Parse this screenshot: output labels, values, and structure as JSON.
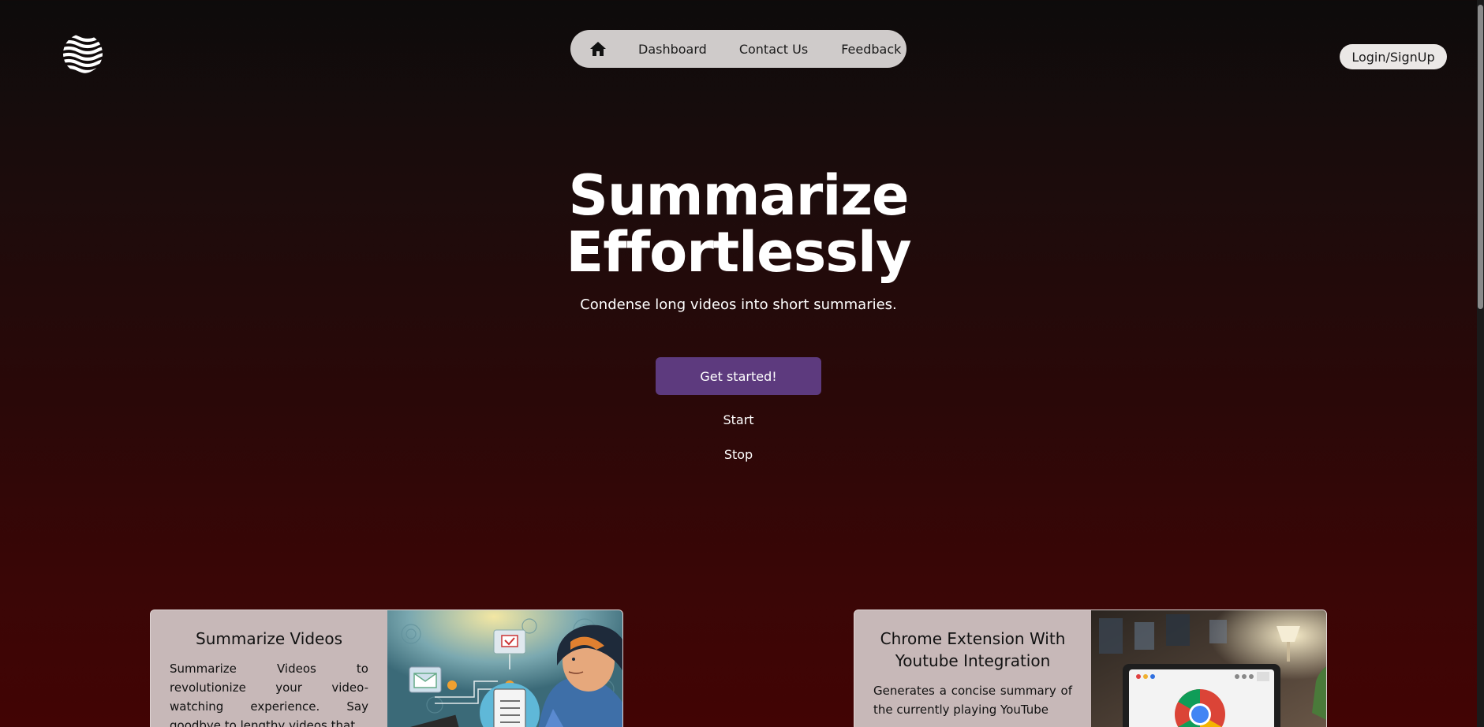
{
  "logo": {
    "icon": "wave-globe-logo"
  },
  "nav": {
    "home_icon": "home-icon",
    "items": [
      {
        "label": "Dashboard"
      },
      {
        "label": "Contact Us"
      },
      {
        "label": "Feedback"
      }
    ]
  },
  "auth": {
    "login_label": "Login/SignUp"
  },
  "hero": {
    "title_line1": "Summarize",
    "title_line2": "Effortlessly",
    "subtitle": "Condense long videos into short summaries.",
    "cta_label": "Get started!",
    "start_label": "Start",
    "stop_label": "Stop"
  },
  "cards": [
    {
      "title": "Summarize Videos",
      "description": "Summarize Videos to revolutionize your video-watching experience. Say goodbye to lengthy videos that",
      "image": "illustration-person-with-documents"
    },
    {
      "title": "Chrome Extension With Youtube Integration",
      "description": "Generates a concise summary of the currently playing YouTube",
      "image": "laptop-with-chrome-logo"
    }
  ],
  "colors": {
    "accent": "#5d3a7e",
    "nav_bg": "#cfcbca",
    "card_bg": "#c7b8b8",
    "bg_top": "#0d0b0b",
    "bg_bottom": "#420404"
  }
}
